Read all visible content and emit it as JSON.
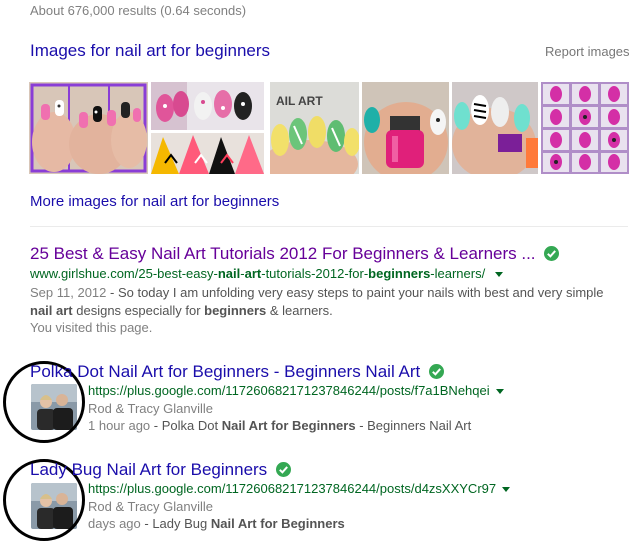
{
  "results_stats": "About 676,000 results (0.64 seconds)",
  "images": {
    "title": "Images for nail art for beginners",
    "report": "Report images",
    "more": "More images for nail art for beginners",
    "thumb_text": "AIL ART"
  },
  "results": [
    {
      "title": "25 Best & Easy Nail Art Tutorials 2012 For Beginners & Learners ...",
      "url_pre": "www.girlshue.com/25-best-easy-",
      "url_b1": "nail",
      "url_m1": "-",
      "url_b2": "art",
      "url_m2": "-tutorials-2012-for-",
      "url_b3": "beginners",
      "url_post": "-learners/",
      "date": "Sep 11, 2012",
      "snip_1": " - So today I am unfolding very easy steps to paint your nails with best and very simple",
      "snip_b1": "nail art",
      "snip_2": " designs especially for ",
      "snip_b2": "beginners",
      "snip_3": " & learners.",
      "visited": "You visited this page."
    },
    {
      "title": "Polka Dot Nail Art for Beginners - Beginners Nail Art",
      "url": "https://plus.google.com/117260682171237846244/posts/f7a1BNehqei",
      "author": "Rod & Tracy Glanville",
      "time": "1 hour ago",
      "snip_pre": " - Polka Dot ",
      "snip_b": "Nail Art for Beginners",
      "snip_post": " - Beginners Nail Art"
    },
    {
      "title": "Lady Bug Nail Art for Beginners",
      "url": "https://plus.google.com/117260682171237846244/posts/d4zsXXYCr97",
      "author": "Rod & Tracy Glanville",
      "time": "days ago",
      "snip_pre": " - Lady Bug ",
      "snip_b": "Nail Art for Beginners",
      "snip_post": ""
    }
  ],
  "colors": {
    "link": "#1a0dab",
    "visited": "#660099",
    "url_green": "#006621",
    "check_green": "#34a853"
  }
}
